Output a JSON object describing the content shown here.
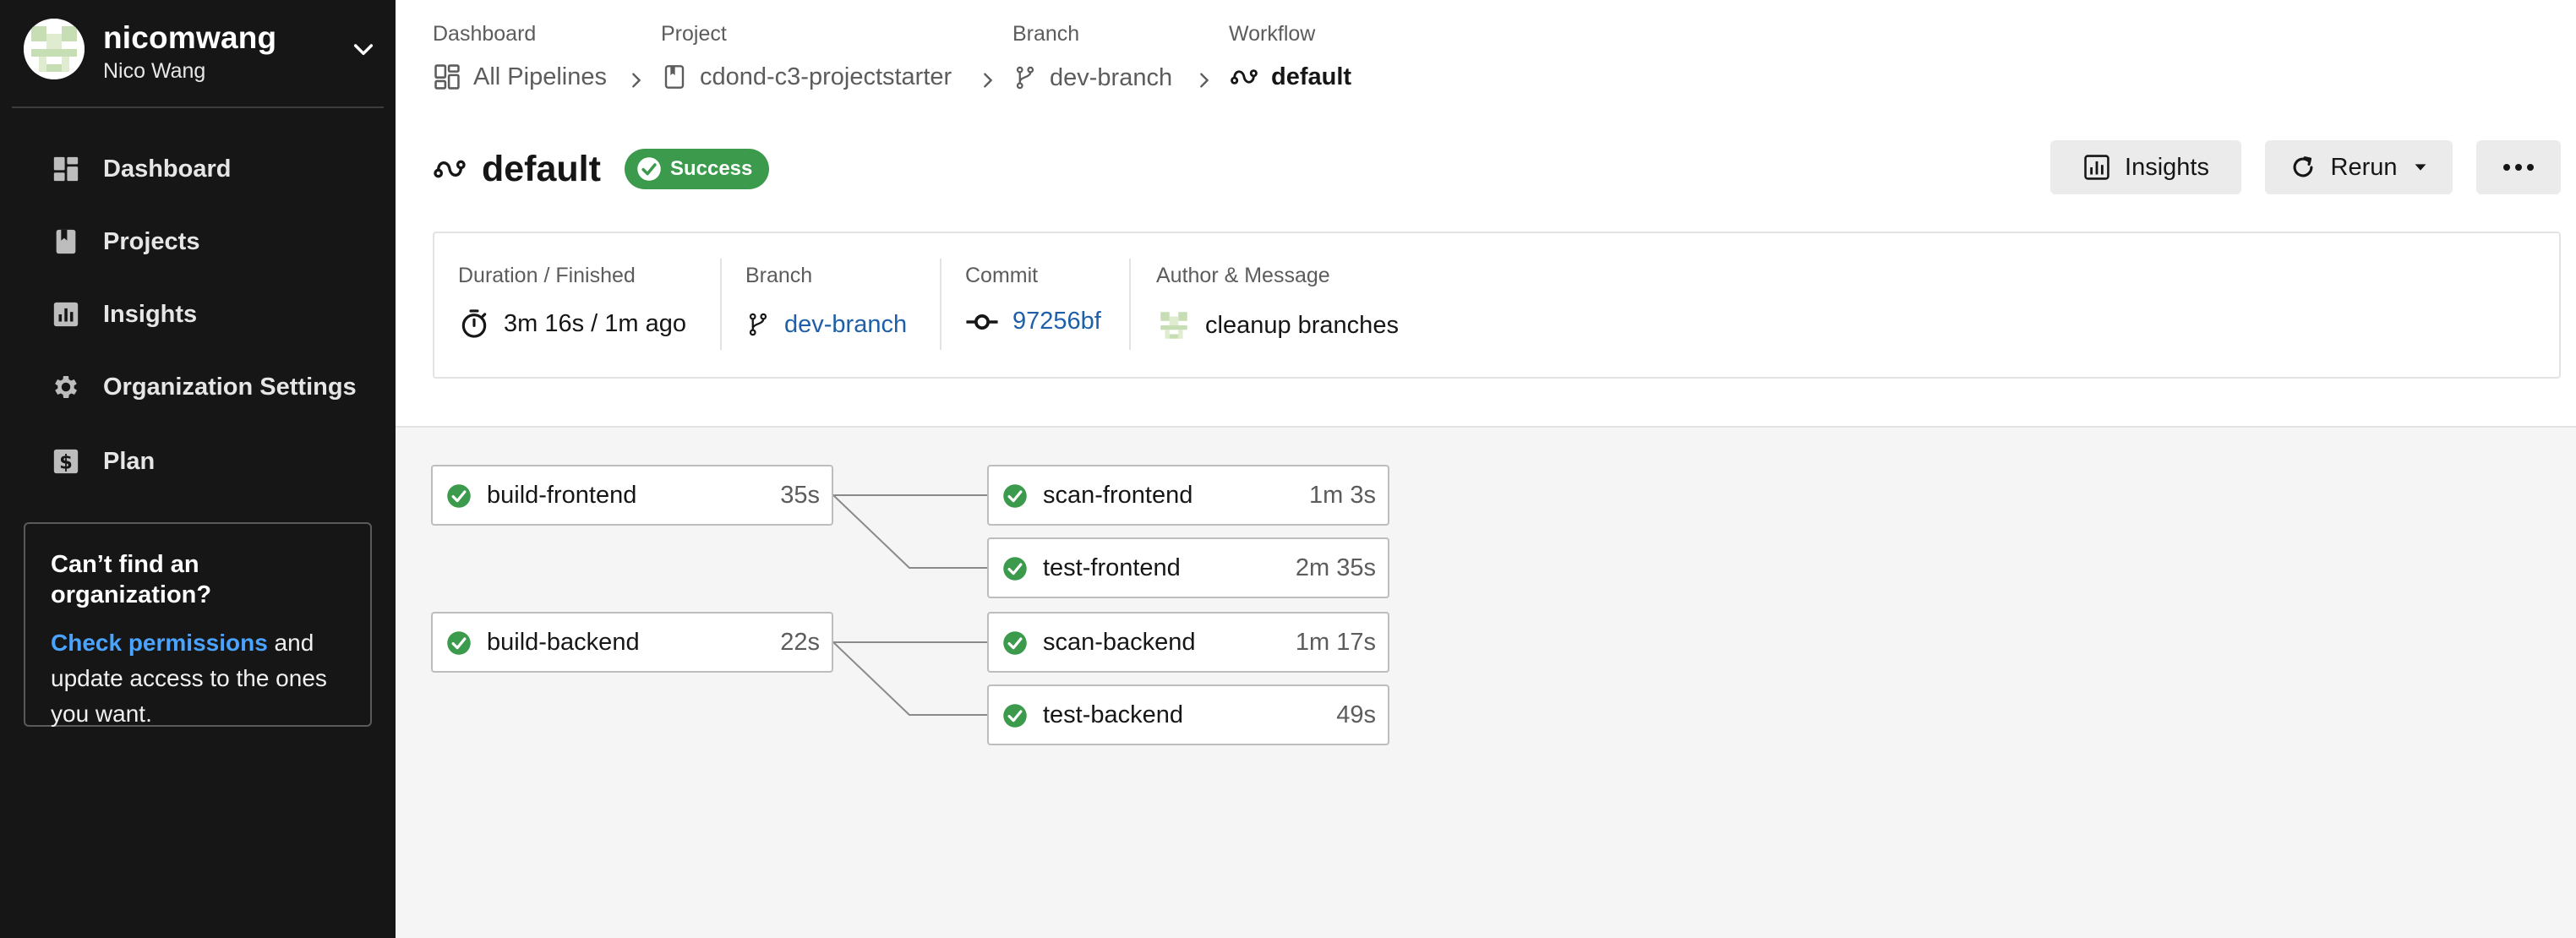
{
  "sidebar": {
    "user": {
      "handle": "nicomwang",
      "name": "Nico Wang"
    },
    "nav": [
      {
        "label": "Dashboard",
        "icon": "dashboard-icon"
      },
      {
        "label": "Projects",
        "icon": "projects-icon"
      },
      {
        "label": "Insights",
        "icon": "insights-icon"
      },
      {
        "label": "Organization Settings",
        "icon": "gear-icon"
      },
      {
        "label": "Plan",
        "icon": "dollar-icon"
      }
    ],
    "notice": {
      "title": "Can’t find an organization?",
      "link": "Check permissions",
      "body": " and update access to the ones you want."
    }
  },
  "breadcrumb": [
    {
      "label": "Dashboard",
      "value": "All Pipelines",
      "icon": "dashboard-icon"
    },
    {
      "label": "Project",
      "value": "cdond-c3-projectstarter",
      "icon": "project-icon"
    },
    {
      "label": "Branch",
      "value": "dev-branch",
      "icon": "branch-icon"
    },
    {
      "label": "Workflow",
      "value": "default",
      "icon": "workflow-icon"
    }
  ],
  "header": {
    "title": "default",
    "status": "Success",
    "insights_label": "Insights",
    "rerun_label": "Rerun"
  },
  "info": {
    "duration_label": "Duration / Finished",
    "duration_value": "3m 16s / 1m ago",
    "branch_label": "Branch",
    "branch_value": "dev-branch",
    "commit_label": "Commit",
    "commit_value": "97256bf",
    "author_label": "Author & Message",
    "author_message": "cleanup branches"
  },
  "jobs": [
    {
      "name": "build-frontend",
      "duration": "35s",
      "status": "success"
    },
    {
      "name": "scan-frontend",
      "duration": "1m 3s",
      "status": "success"
    },
    {
      "name": "test-frontend",
      "duration": "2m 35s",
      "status": "success"
    },
    {
      "name": "build-backend",
      "duration": "22s",
      "status": "success"
    },
    {
      "name": "scan-backend",
      "duration": "1m 17s",
      "status": "success"
    },
    {
      "name": "test-backend",
      "duration": "49s",
      "status": "success"
    }
  ],
  "colors": {
    "sidebar_bg": "#161616",
    "success": "#3b9a4b",
    "link": "#1e5fa8",
    "notice_link": "#4aa3ff"
  }
}
